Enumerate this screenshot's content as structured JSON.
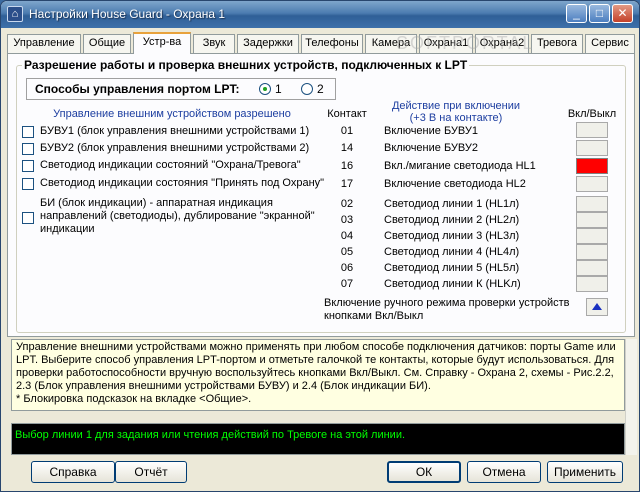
{
  "window": {
    "title": "Настройки House Guard - Охрана 1",
    "minimize": "_",
    "maximize": "□",
    "close": "✕"
  },
  "tabs": [
    {
      "label": "Управление"
    },
    {
      "label": "Общие"
    },
    {
      "label": "Устр-ва"
    },
    {
      "label": "Звук"
    },
    {
      "label": "Задержки"
    },
    {
      "label": "Телефоны"
    },
    {
      "label": "Камера"
    },
    {
      "label": "Охрана1"
    },
    {
      "label": "Охрана2"
    },
    {
      "label": "Тревога"
    },
    {
      "label": "Сервис"
    }
  ],
  "group": {
    "title": "Разрешение работы и проверка внешних устройств, подключенных к LPT",
    "lpt_label": "Способы управления портом LPT:",
    "radio1": "1",
    "radio2": "2",
    "col_devices": "Управление внешним устройством разрешено",
    "col_contact": "Контакт",
    "col_action_line1": "Действие при включении",
    "col_action_line2": "(+3 В на контакте)",
    "col_toggle": "Вкл/Выкл"
  },
  "devices": [
    {
      "label": "БУВУ1 (блок управления внешними устройствами 1)"
    },
    {
      "label": "БУВУ2 (блок управления внешними устройствами 2)"
    },
    {
      "label": "Светодиод индикации состояний \"Охрана/Тревога\""
    },
    {
      "label": "Светодиод индикации состояния \"Принять под Охрану\""
    },
    {
      "label_line1": "БИ (блок индикации) - аппаратная индикация",
      "label_line2": "направлений (светодиоды), дублирование \"экранной\"",
      "label_line3": "индикации"
    }
  ],
  "rows": [
    {
      "contact": "01",
      "action": "Включение БУВУ1",
      "on": false
    },
    {
      "contact": "14",
      "action": "Включение БУВУ2",
      "on": false
    },
    {
      "contact": "16",
      "action": "Вкл./мигание светодиода HL1",
      "on": true
    },
    {
      "contact": "17",
      "action": "Включение светодиода HL2",
      "on": false
    },
    {
      "contact": "02",
      "action": "Светодиод линии 1 (HL1л)",
      "on": false
    },
    {
      "contact": "03",
      "action": "Светодиод линии 2 (HL2л)",
      "on": false
    },
    {
      "contact": "04",
      "action": "Светодиод линии 3 (HL3л)",
      "on": false
    },
    {
      "contact": "05",
      "action": "Светодиод линии 4 (HL4л)",
      "on": false
    },
    {
      "contact": "06",
      "action": "Светодиод линии 5 (HL5л)",
      "on": false
    },
    {
      "contact": "07",
      "action": "Светодиод линии К (HLKл)",
      "on": false
    }
  ],
  "manual": {
    "line1": "Включение ручного режима проверки устройств",
    "line2": "кнопками Вкл/Выкл"
  },
  "help": {
    "line1": "Управление внешними устройствами можно применять при любом способе подключения датчиков: порты Game или",
    "line2": "LPT. Выберите способ управления LPT-портом и отметьте галочкой те контакты, которые будут использоваться. Для",
    "line3": "проверки работоспособности вручную воспользуйтесь кнопками Вкл/Выкл. См. Справку - Охрана 2, схемы - Рис.2.2,",
    "line4": "2.3 (Блок управления внешними устройствами БУВУ) и 2.4 (Блок индикации БИ).",
    "line5": "* Блокировка подсказок на вкладке <Общие>."
  },
  "status": {
    "text": "Выбор линии 1 для задания или чтения действий по Тревоге на этой линии."
  },
  "buttons": {
    "help": "Справка",
    "report": "Отчёт",
    "ok": "ОК",
    "cancel": "Отмена",
    "apply": "Применить"
  },
  "watermark": "SOFTPORTAL",
  "colors": {
    "toggle_on": "#ff0000",
    "status_text": "#00ff00",
    "accent_heading": "#1d3ea0"
  }
}
